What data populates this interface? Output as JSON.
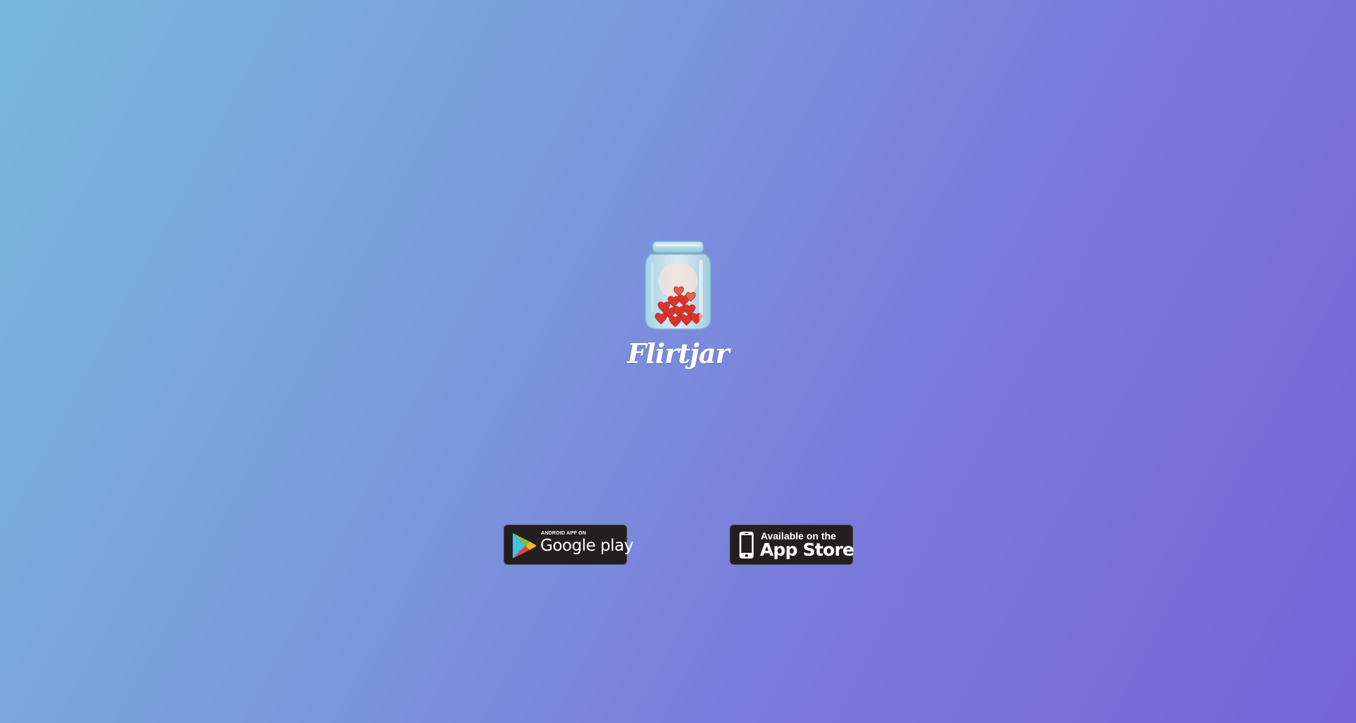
{
  "brand": {
    "name": "Flirtjar",
    "logo_icon": "jar-of-hearts-icon"
  },
  "stores": {
    "google_play": {
      "small_label": "ANDROID APP ON",
      "big_label": "Google play",
      "icon": "google-play-triangle-icon"
    },
    "app_store": {
      "small_label": "Available on the",
      "big_label": "App Store",
      "icon": "iphone-icon"
    }
  },
  "colors": {
    "gradient_start": "#79b8dd",
    "gradient_end": "#7764d6",
    "badge_background": "#231f20",
    "heart_red": "#d9342b"
  }
}
